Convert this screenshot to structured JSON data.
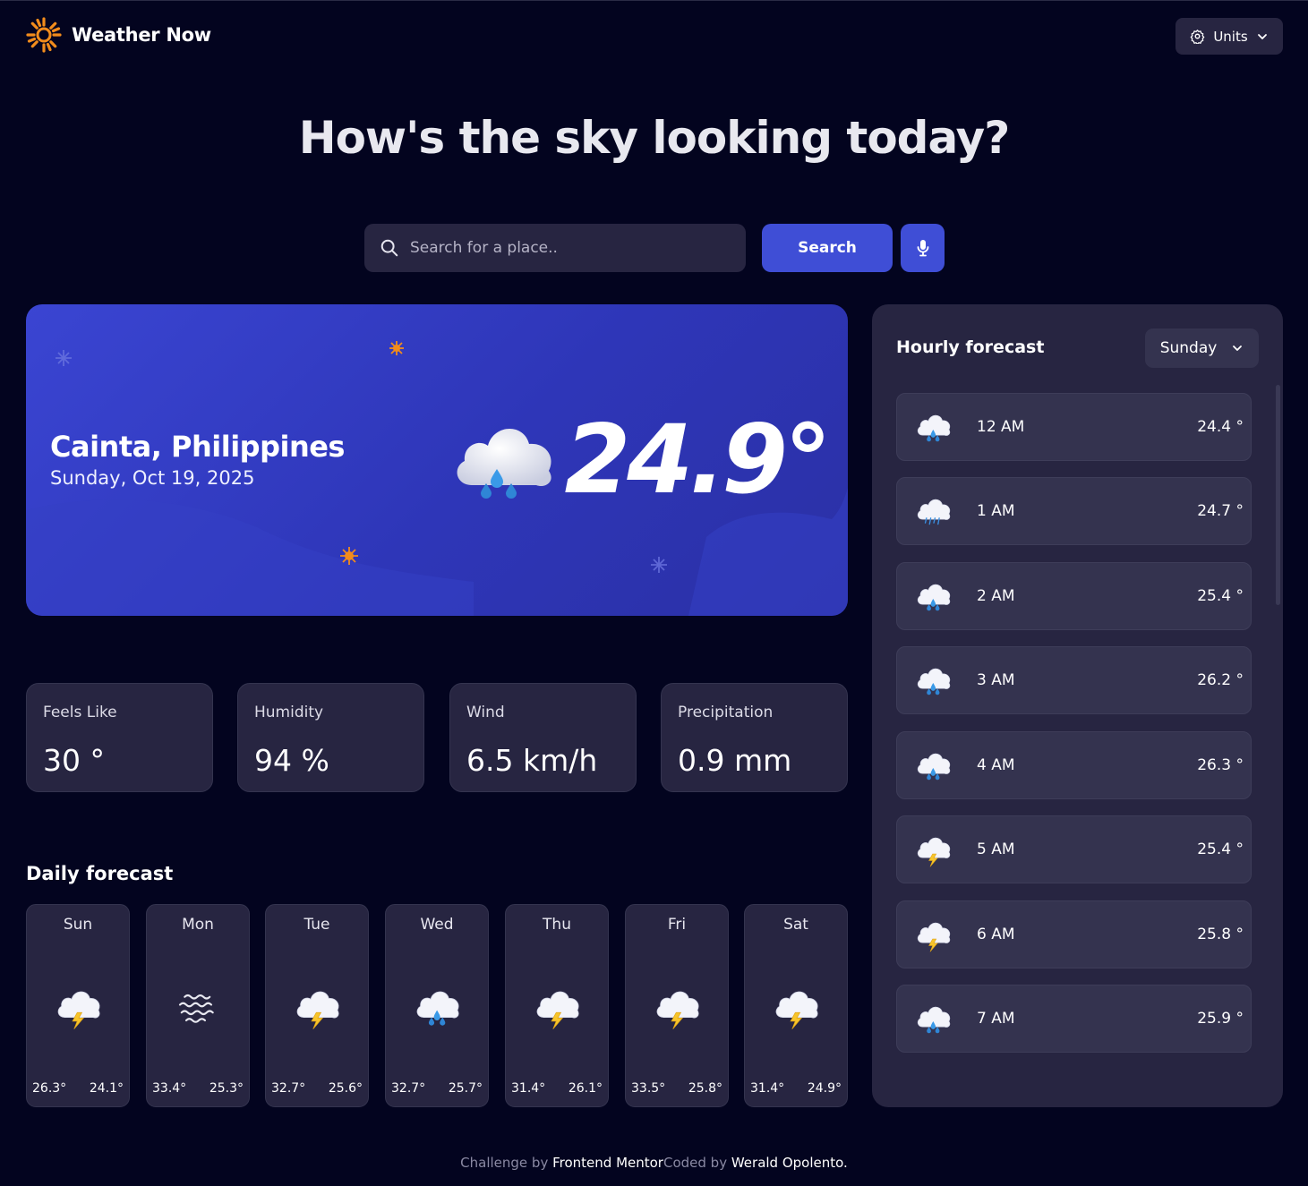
{
  "app": {
    "title": "Weather Now"
  },
  "header": {
    "units_label": "Units"
  },
  "hero": {
    "title": "How's the sky looking today?"
  },
  "search": {
    "placeholder": "Search for a place..",
    "button_label": "Search"
  },
  "current": {
    "location": "Cainta, Philippines",
    "date": "Sunday, Oct 19, 2025",
    "temperature": "24.9°",
    "icon": "rain-cloud-icon"
  },
  "stats": [
    {
      "label": "Feels Like",
      "value": "30 °"
    },
    {
      "label": "Humidity",
      "value": "94 %"
    },
    {
      "label": "Wind",
      "value": "6.5 km/h"
    },
    {
      "label": "Precipitation",
      "value": "0.9 mm"
    }
  ],
  "daily": {
    "title": "Daily forecast",
    "days": [
      {
        "day": "Sun",
        "icon": "storm",
        "high": "26.3°",
        "low": "24.1°"
      },
      {
        "day": "Mon",
        "icon": "fog",
        "high": "33.4°",
        "low": "25.3°"
      },
      {
        "day": "Tue",
        "icon": "storm",
        "high": "32.7°",
        "low": "25.6°"
      },
      {
        "day": "Wed",
        "icon": "rain",
        "high": "32.7°",
        "low": "25.7°"
      },
      {
        "day": "Thu",
        "icon": "storm",
        "high": "31.4°",
        "low": "26.1°"
      },
      {
        "day": "Fri",
        "icon": "storm",
        "high": "33.5°",
        "low": "25.8°"
      },
      {
        "day": "Sat",
        "icon": "storm",
        "high": "31.4°",
        "low": "24.9°"
      }
    ]
  },
  "hourly": {
    "title": "Hourly forecast",
    "selected_day": "Sunday",
    "hours": [
      {
        "time": "12 AM",
        "icon": "rain",
        "temp": "24.4 °"
      },
      {
        "time": "1 AM",
        "icon": "drizzle",
        "temp": "24.7 °"
      },
      {
        "time": "2 AM",
        "icon": "rain",
        "temp": "25.4 °"
      },
      {
        "time": "3 AM",
        "icon": "rain",
        "temp": "26.2 °"
      },
      {
        "time": "4 AM",
        "icon": "rain",
        "temp": "26.3 °"
      },
      {
        "time": "5 AM",
        "icon": "storm",
        "temp": "25.4 °"
      },
      {
        "time": "6 AM",
        "icon": "storm",
        "temp": "25.8 °"
      },
      {
        "time": "7 AM",
        "icon": "rain",
        "temp": "25.9 °"
      }
    ]
  },
  "footer": {
    "challenge_prefix": "Challenge by ",
    "challenge_link": "Frontend Mentor",
    "coded_prefix": "Coded by ",
    "coded_link": "Werald Opolento",
    "suffix": "."
  },
  "colors": {
    "background": "#03041f",
    "card": "#272541",
    "card_inner": "#34334f",
    "accent": "#3f4ed6",
    "sun": "#f28c1c"
  }
}
